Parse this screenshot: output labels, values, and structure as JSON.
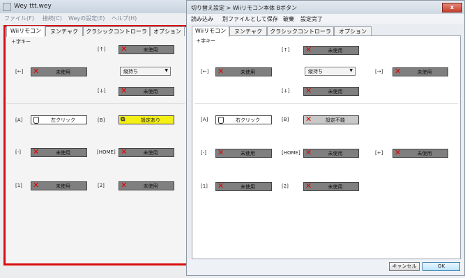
{
  "back": {
    "title": "Wey ttt.wey",
    "menu": [
      "ファイル(F)",
      "接続(C)",
      "Weyの設定(E)",
      "ヘルプ(H)"
    ],
    "tabs": [
      "Wiiリモコン",
      "ヌンチャク",
      "クラシックコントローラ",
      "オプション"
    ],
    "section": "＋字キー",
    "fields": [
      {
        "label": "[↑]",
        "value": "未使用",
        "style": "unused"
      },
      {
        "label": "[←]",
        "value": "未使用",
        "style": "unused"
      },
      {
        "label": "",
        "value": "縦持ち",
        "style": "combo"
      },
      {
        "label": "[↓]",
        "value": "未使用",
        "style": "unused"
      },
      {
        "label": "[A]",
        "value": "左クリック",
        "style": "mouse"
      },
      {
        "label": "[B]",
        "value": "設定あり",
        "style": "yellow"
      },
      {
        "label": "[-]",
        "value": "未使用",
        "style": "unused"
      },
      {
        "label": "[HOME]",
        "value": "未使用",
        "style": "unused"
      },
      {
        "label": "[1]",
        "value": "未使用",
        "style": "unused"
      },
      {
        "label": "[2]",
        "value": "未使用",
        "style": "unused"
      }
    ]
  },
  "front": {
    "title": "切り替え設定 > Wiiリモコン本体 Bボタン",
    "close": "x",
    "menu": [
      "読み込み",
      "別ファイルとして保存",
      "破棄",
      "設定完了"
    ],
    "tabs": [
      "Wiiリモコン",
      "ヌンチャク",
      "クラシックコントローラ",
      "オプション"
    ],
    "section": "＋字キー",
    "fields": [
      {
        "label": "[↑]",
        "value": "未使用",
        "style": "unused"
      },
      {
        "label": "[←]",
        "value": "未使用",
        "style": "unused"
      },
      {
        "label": "",
        "value": "縦持ち",
        "style": "combo"
      },
      {
        "label": "[→]",
        "value": "未使用",
        "style": "unused"
      },
      {
        "label": "[↓]",
        "value": "未使用",
        "style": "unused"
      },
      {
        "label": "[A]",
        "value": "右クリック",
        "style": "mouse"
      },
      {
        "label": "[B]",
        "value": "設定不能",
        "style": "disabled"
      },
      {
        "label": "[-]",
        "value": "未使用",
        "style": "unused"
      },
      {
        "label": "[HOME]",
        "value": "未使用",
        "style": "unused"
      },
      {
        "label": "[+]",
        "value": "未使用",
        "style": "unused"
      },
      {
        "label": "[1]",
        "value": "未使用",
        "style": "unused"
      },
      {
        "label": "[2]",
        "value": "未使用",
        "style": "unused"
      }
    ],
    "cancel": "キャンセル",
    "ok": "OK"
  },
  "colors": {
    "highlight_frame": "#d90d0d",
    "unused_button": "#7f7f7f",
    "set_button": "#f4f016",
    "disabled_button": "#c8c8c8"
  }
}
